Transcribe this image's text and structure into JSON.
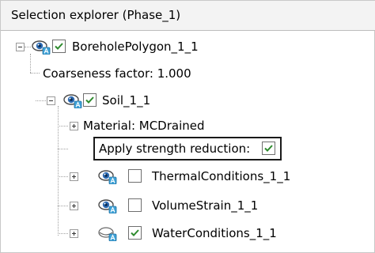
{
  "panel": {
    "title": "Selection explorer (Phase_1)"
  },
  "tree": {
    "borehole": {
      "label": "BoreholePolygon_1_1",
      "checked": true,
      "expanded": true,
      "visibility": "visible"
    },
    "coarseness": {
      "label": "Coarseness factor: 1.000"
    },
    "soil": {
      "label": "Soil_1_1",
      "checked": true,
      "expanded": true,
      "visibility": "visible"
    },
    "material": {
      "label": "Material: MCDrained",
      "expanded": false
    },
    "strength_reduction": {
      "label": "Apply strength reduction:",
      "checked": true
    },
    "thermal": {
      "label": "ThermalConditions_1_1",
      "checked": false,
      "expanded": false,
      "visibility": "visible"
    },
    "volume_strain": {
      "label": "VolumeStrain_1_1",
      "checked": false,
      "expanded": false,
      "visibility": "visible"
    },
    "water": {
      "label": "WaterConditions_1_1",
      "checked": true,
      "expanded": false,
      "visibility": "hidden"
    }
  },
  "colors": {
    "check_green": "#2e8b2e",
    "eye_blue": "#2d6bb3",
    "header_bg": "#f3f3f3"
  }
}
